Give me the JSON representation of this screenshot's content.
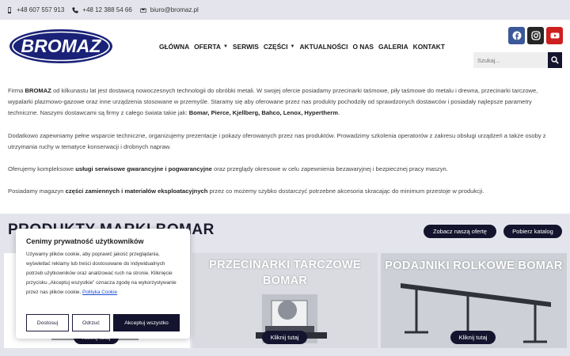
{
  "topbar": {
    "phone1": "+48 607 557 913",
    "phone2": "+48 12 388 54 66",
    "email": "biuro@bromaz.pl"
  },
  "logo": {
    "text": "BROMAZ"
  },
  "nav": {
    "items": [
      {
        "label": "GŁÓWNA",
        "dropdown": false
      },
      {
        "label": "OFERTA",
        "dropdown": true
      },
      {
        "label": "SERWIS",
        "dropdown": false
      },
      {
        "label": "CZĘŚCI",
        "dropdown": true
      },
      {
        "label": "AKTUALNOŚCI",
        "dropdown": false
      },
      {
        "label": "O NAS",
        "dropdown": false
      },
      {
        "label": "GALERIA",
        "dropdown": false
      },
      {
        "label": "KONTAKT",
        "dropdown": false
      }
    ]
  },
  "socials": [
    {
      "name": "facebook-icon",
      "color": "#3b5998"
    },
    {
      "name": "instagram-icon",
      "color": "#262626"
    },
    {
      "name": "youtube-icon",
      "color": "#cd201f"
    }
  ],
  "search": {
    "placeholder": "Szukaj..."
  },
  "content": {
    "p1_a": "Firma ",
    "p1_brand": "BROMAZ",
    "p1_b": " od kilkunastu lat jest dostawcą nowoczesnych technologii do obróbki metali. W swojej ofercie posiadamy przecinarki taśmowe, piły taśmowe do metalu i drewna, przecinarki tarczowe, wypalarki plazmowo-gazowe oraz inne urządzenia stosowane w przemyśle. Staramy się aby oferowane przez nas produkty pochodziły od sprawdzonych dostawców i posiadały najlepsze parametry techniczne. Naszymi dostawcami są firmy z całego świata takie jak: ",
    "p1_brands": "Bomar, Pierce, Kjellberg, Bahco, Lenox, Hypertherm",
    "p1_c": ".",
    "p2": "Dodatkowo zapewniamy pełne wsparcie techniczne, organizujemy prezentacje i pokazy oferowanych przez nas produktów. Prowadzimy szkolenia operatorów z zakresu obsługi urządzeń a także osoby z utrzymania ruchy w tematyce konserwacji i drobnych napraw.",
    "p3_a": "Oferujemy kompleksowe ",
    "p3_b": "usługi serwisowe gwarancyjne i pogwarancyjne",
    "p3_c": " oraz przeglądy okresowe w celu zapewnienia bezawaryjnej i bezpiecznej pracy maszyn.",
    "p4_a": "Posiadamy magazyn ",
    "p4_b": "części zamiennych i materiałów eksploatacyjnych",
    "p4_c": " przez co możemy szybko dostarczyć potrzebne akcesoria skracając do minimum przestoje w produkcji."
  },
  "products": {
    "title": "PRODUKTY MARKI BOMAR",
    "offer_button": "Zobacz naszą ofertę",
    "catalog_button": "Pobierz katalog",
    "cards": [
      {
        "title": "",
        "button": "Kliknij tutaj"
      },
      {
        "title": "PRZECINARKI TARCZOWE BOMAR",
        "button": "Kliknij tutaj"
      },
      {
        "title": "PODAJNIKI ROLKOWE BOMAR",
        "button": "Kliknij tutaj"
      }
    ]
  },
  "cookie": {
    "title": "Cenimy prywatność użytkowników",
    "text": "Używamy plików cookie, aby poprawić jakość przeglądania, wyświetlać reklamy lub treści dostosowane do indywidualnych potrzeb użytkowników oraz analizować ruch na stronie. Kliknięcie przycisku „Akceptuj wszystkie” oznacza zgodę na wykorzystywanie przez nas plików cookie. ",
    "link": "Polityka Cookie",
    "customize": "Dostosuj",
    "reject": "Odrzuć",
    "accept": "Akceptuj wszystko"
  }
}
